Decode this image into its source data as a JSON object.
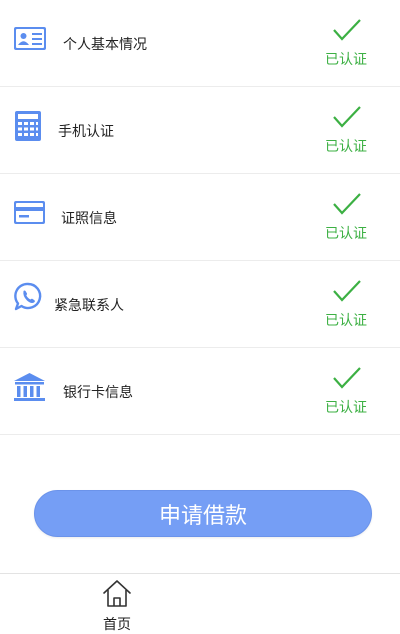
{
  "items": [
    {
      "label": "个人基本情况",
      "status": "已认证",
      "icon": "id-card-icon"
    },
    {
      "label": "手机认证",
      "status": "已认证",
      "icon": "calculator-icon"
    },
    {
      "label": "证照信息",
      "status": "已认证",
      "icon": "credit-card-icon"
    },
    {
      "label": "紧急联系人",
      "status": "已认证",
      "icon": "whatsapp-phone-icon"
    },
    {
      "label": "银行卡信息",
      "status": "已认证",
      "icon": "bank-icon"
    }
  ],
  "apply_button": {
    "label": "申请借款"
  },
  "tabbar": {
    "home_label": "首页",
    "home_icon": "home-icon"
  },
  "colors": {
    "accent": "#759ef5",
    "icon_blue": "#5b8def",
    "verified_green": "#3cb043"
  }
}
